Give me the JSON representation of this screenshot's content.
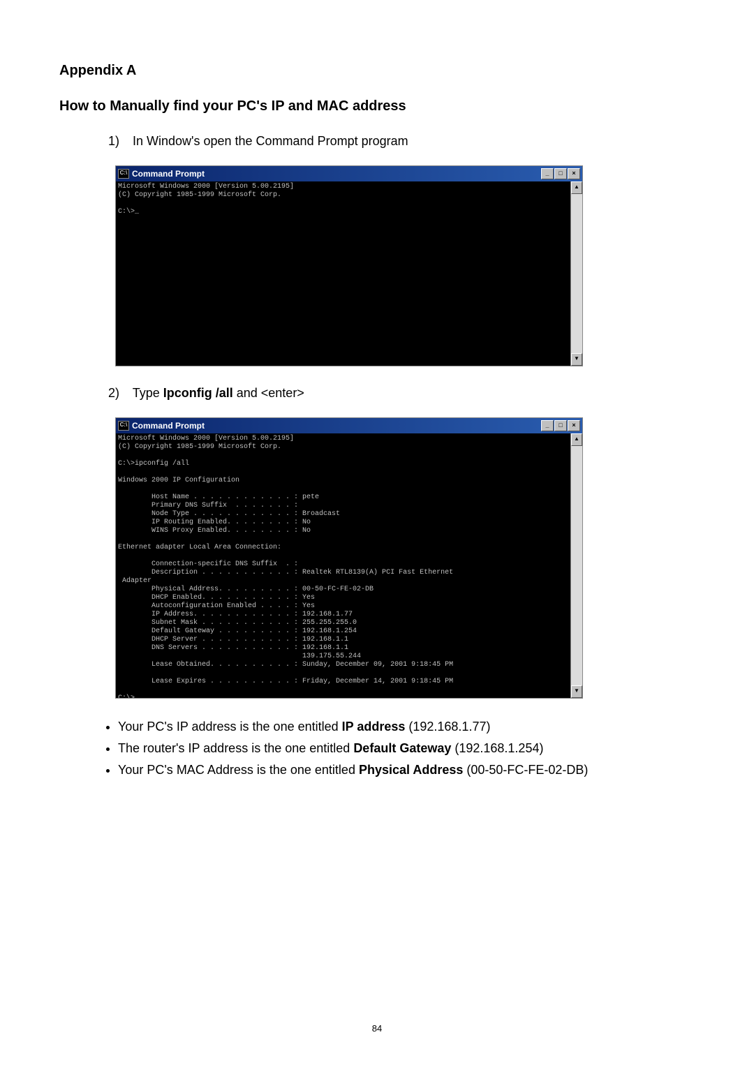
{
  "heading1": "Appendix A",
  "heading2": "How to Manually find your PC's IP and MAC address",
  "step1_num": "1)",
  "step1_text": "In Window's open the Command Prompt program",
  "step2_num": "2)",
  "step2_pre": "Type ",
  "step2_bold": "Ipconfig /all",
  "step2_post": " and <enter>",
  "window_title": "Command Prompt",
  "win_min": "_",
  "win_max": "□",
  "win_close": "×",
  "scroll_up": "▲",
  "scroll_down": "▼",
  "console1_text": "Microsoft Windows 2000 [Version 5.00.2195]\n(C) Copyright 1985-1999 Microsoft Corp.\n\nC:\\>_",
  "console2_text": "Microsoft Windows 2000 [Version 5.00.2195]\n(C) Copyright 1985-1999 Microsoft Corp.\n\nC:\\>ipconfig /all\n\nWindows 2000 IP Configuration\n\n        Host Name . . . . . . . . . . . . : pete\n        Primary DNS Suffix  . . . . . . . :\n        Node Type . . . . . . . . . . . . : Broadcast\n        IP Routing Enabled. . . . . . . . : No\n        WINS Proxy Enabled. . . . . . . . : No\n\nEthernet adapter Local Area Connection:\n\n        Connection-specific DNS Suffix  . :\n        Description . . . . . . . . . . . : Realtek RTL8139(A) PCI Fast Ethernet\n Adapter\n        Physical Address. . . . . . . . . : 00-50-FC-FE-02-DB\n        DHCP Enabled. . . . . . . . . . . : Yes\n        Autoconfiguration Enabled . . . . : Yes\n        IP Address. . . . . . . . . . . . : 192.168.1.77\n        Subnet Mask . . . . . . . . . . . : 255.255.255.0\n        Default Gateway . . . . . . . . . : 192.168.1.254\n        DHCP Server . . . . . . . . . . . : 192.168.1.1\n        DNS Servers . . . . . . . . . . . : 192.168.1.1\n                                            139.175.55.244\n        Lease Obtained. . . . . . . . . . : Sunday, December 09, 2001 9:18:45 PM\n\n        Lease Expires . . . . . . . . . . : Friday, December 14, 2001 9:18:45 PM\n\nC:\\>_",
  "bullet1_pre": "Your PC's IP address is the one entitled ",
  "bullet1_bold": "IP address",
  "bullet1_post": " (192.168.1.77)",
  "bullet2_pre": "The router's IP address is the one entitled ",
  "bullet2_bold": "Default Gateway",
  "bullet2_post": " (192.168.1.254)",
  "bullet3_pre": "Your PC's MAC Address is the one entitled ",
  "bullet3_bold": "Physical Address",
  "bullet3_post": "  (00-50-FC-FE-02-DB)",
  "page_number": "84"
}
